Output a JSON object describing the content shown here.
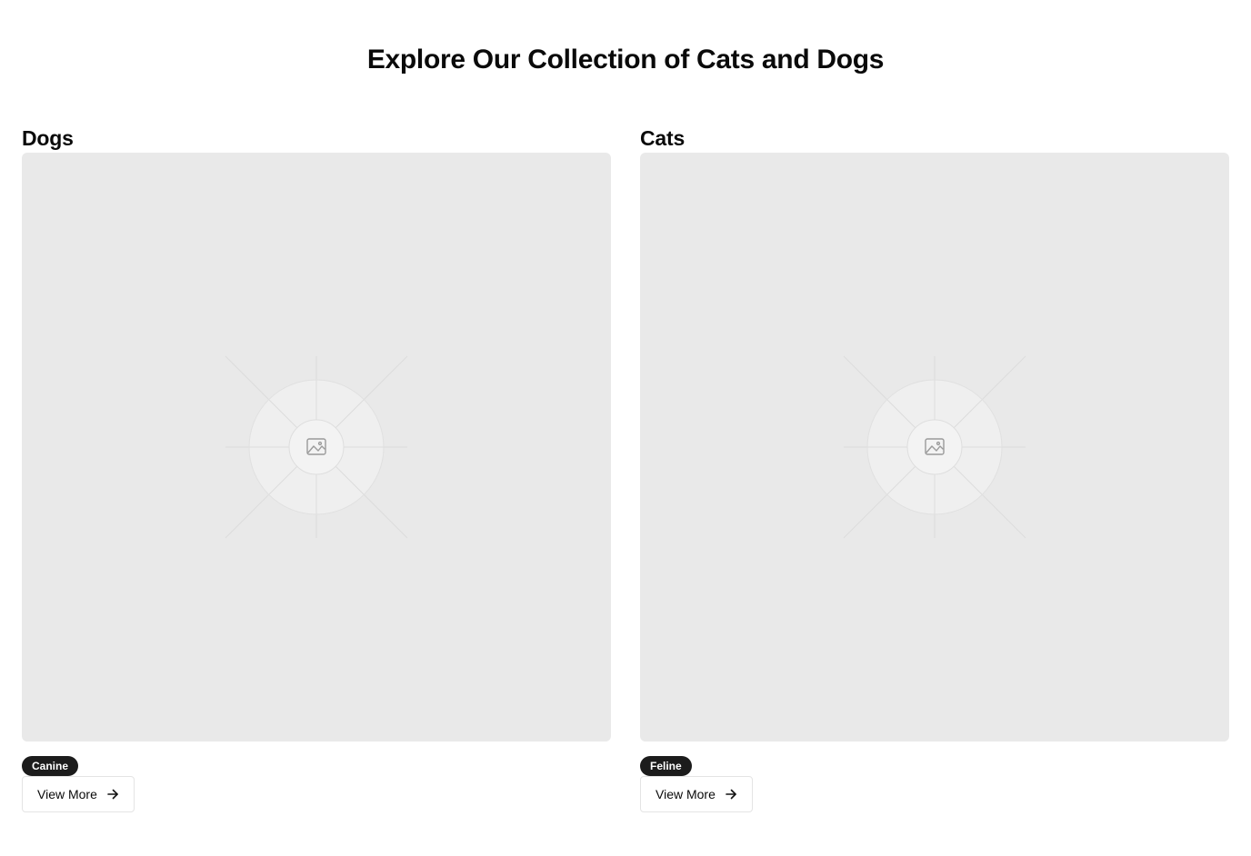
{
  "page": {
    "title": "Explore Our Collection of Cats and Dogs"
  },
  "sections": [
    {
      "title": "Dogs",
      "badge": "Canine",
      "button_label": "View More",
      "image_icon": "image-placeholder-icon",
      "button_icon": "arrow-right-icon"
    },
    {
      "title": "Cats",
      "badge": "Feline",
      "button_label": "View More",
      "image_icon": "image-placeholder-icon",
      "button_icon": "arrow-right-icon"
    }
  ],
  "colors": {
    "placeholder_bg": "#e9e9e9",
    "badge_bg": "#1c1c1c",
    "text": "#0a0a0a"
  }
}
